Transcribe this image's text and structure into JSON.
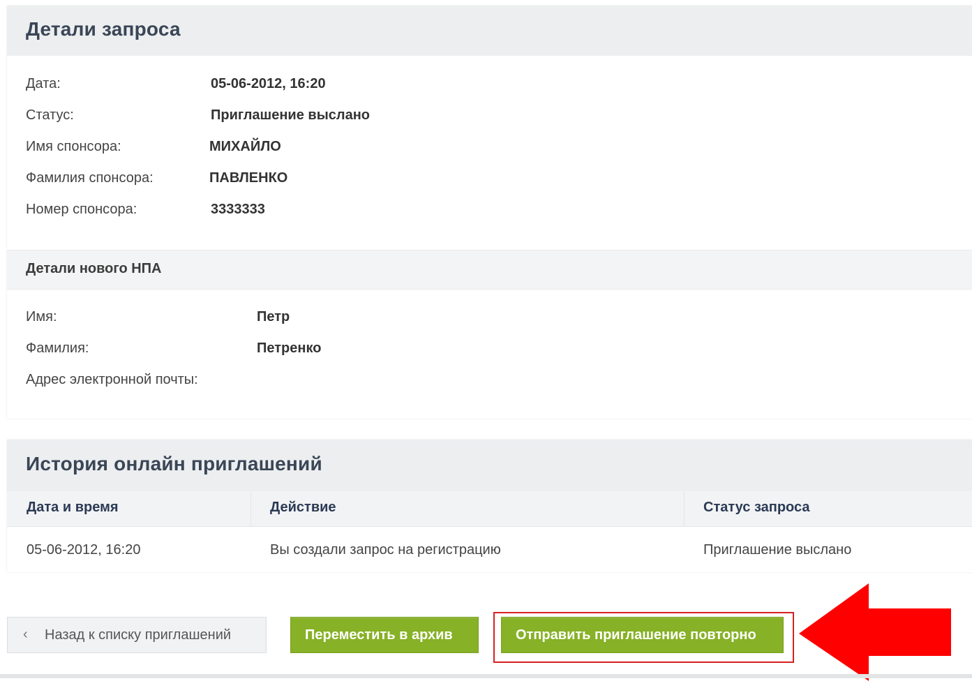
{
  "details": {
    "title": "Детали запроса",
    "rows": [
      {
        "label": "Дата:",
        "value": "05-06-2012, 16:20"
      },
      {
        "label": "Статус:",
        "value": "Приглашение выслано"
      },
      {
        "label": "Имя спонсора:",
        "value": "МИХАЙЛО"
      },
      {
        "label": "Фамилия спонсора:",
        "value": "ПАВЛЕНКО"
      },
      {
        "label": "Номер спонсора:",
        "value": "3333333"
      }
    ],
    "new_npa": {
      "title": "Детали нового НПА",
      "rows": [
        {
          "label": "Имя:",
          "value": "Петр"
        },
        {
          "label": "Фамилия:",
          "value": "Петренко"
        },
        {
          "label": "Адрес электронной почты:",
          "value": ""
        }
      ]
    }
  },
  "history": {
    "title": "История онлайн приглашений",
    "columns": [
      "Дата и время",
      "Действие",
      "Статус запроса"
    ],
    "rows": [
      [
        "05-06-2012, 16:20",
        "Вы создали запрос на регистрацию",
        "Приглашение выслано"
      ]
    ]
  },
  "actions": {
    "back_chevron": "‹",
    "back_label": "Назад к списку приглашений",
    "archive_label": "Переместить в архив",
    "resend_label": "Отправить приглашение повторно"
  },
  "annotation": {
    "arrow_color": "#ff0000",
    "box_color": "#d62020",
    "arrow_icon": "arrow-left-icon"
  },
  "colors": {
    "accent_green": "#87b126",
    "header_bg": "#eceef0",
    "table_header_text": "#2b3a55"
  }
}
